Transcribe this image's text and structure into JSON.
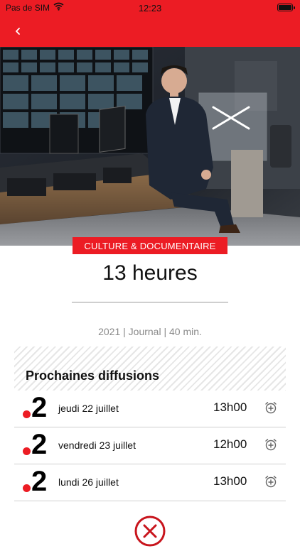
{
  "status_bar": {
    "carrier": "Pas de SIM",
    "time": "12:23"
  },
  "colors": {
    "brand_red": "#ec1c24"
  },
  "program": {
    "category": "CULTURE & DOCUMENTAIRE",
    "title": "13 heures",
    "meta": "2021 | Journal | 40 min."
  },
  "schedule": {
    "heading": "Prochaines diffusions",
    "items": [
      {
        "channel": "2",
        "day": "jeudi 22 juillet",
        "time": "13h00",
        "icon": "alarm-add-icon"
      },
      {
        "channel": "2",
        "day": "vendredi 23 juillet",
        "time": "12h00",
        "icon": "alarm-add-icon"
      },
      {
        "channel": "2",
        "day": "lundi 26 juillet",
        "time": "13h00",
        "icon": "alarm-add-icon"
      }
    ]
  },
  "icons": {
    "back": "chevron-left-icon",
    "close": "close-circle-icon"
  }
}
